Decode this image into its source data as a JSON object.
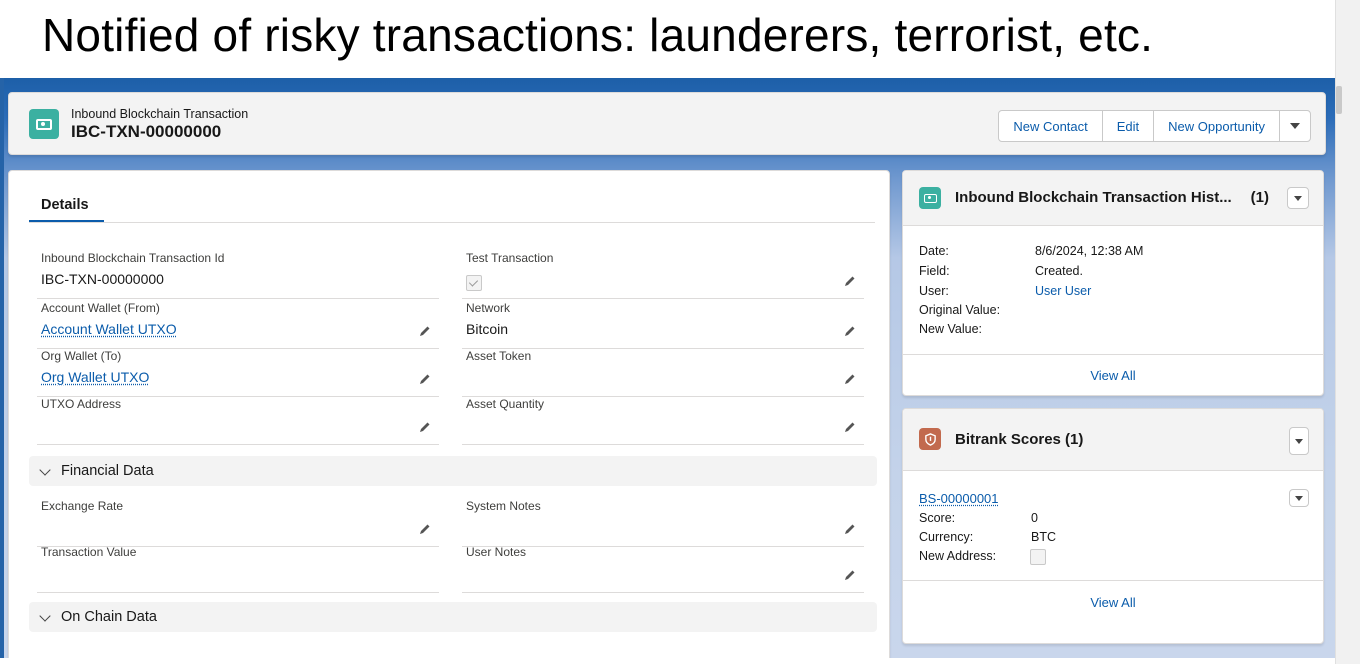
{
  "slide": {
    "title": "Notified of risky transactions: launderers, terrorist, etc."
  },
  "header": {
    "object_label": "Inbound Blockchain Transaction",
    "record_name": "IBC-TXN-00000000",
    "buttons": {
      "new_contact": "New Contact",
      "edit": "Edit",
      "new_opportunity": "New Opportunity"
    }
  },
  "details": {
    "tab_label": "Details",
    "fields": {
      "txn_id": {
        "label": "Inbound Blockchain Transaction Id",
        "value": "IBC-TXN-00000000"
      },
      "test_txn": {
        "label": "Test Transaction",
        "checked": true
      },
      "account_wallet": {
        "label": "Account Wallet (From)",
        "value": "Account Wallet UTXO"
      },
      "network": {
        "label": "Network",
        "value": "Bitcoin"
      },
      "org_wallet": {
        "label": "Org Wallet (To)",
        "value": "Org Wallet UTXO"
      },
      "asset_token": {
        "label": "Asset Token",
        "value": ""
      },
      "utxo_address": {
        "label": "UTXO Address",
        "value": ""
      },
      "asset_quantity": {
        "label": "Asset Quantity",
        "value": ""
      },
      "exchange_rate": {
        "label": "Exchange Rate",
        "value": ""
      },
      "system_notes": {
        "label": "System Notes",
        "value": ""
      },
      "transaction_value": {
        "label": "Transaction Value",
        "value": ""
      },
      "user_notes": {
        "label": "User Notes",
        "value": ""
      }
    },
    "sections": {
      "financial": "Financial Data",
      "on_chain": "On Chain Data"
    }
  },
  "history": {
    "title": "Inbound Blockchain Transaction Hist...",
    "count": "(1)",
    "labels": {
      "date": "Date:",
      "field": "Field:",
      "user": "User:",
      "original": "Original Value:",
      "new": "New Value:"
    },
    "values": {
      "date": "8/6/2024, 12:38 AM",
      "field": "Created.",
      "user": "User User",
      "original": "",
      "new": ""
    },
    "view_all": "View All"
  },
  "bitrank": {
    "title": "Bitrank Scores (1)",
    "record": "BS-00000001",
    "labels": {
      "score": "Score:",
      "currency": "Currency:",
      "new_address": "New Address:"
    },
    "values": {
      "score": "0",
      "currency": "BTC"
    },
    "view_all": "View All"
  },
  "colors": {
    "brand_blue": "#0b5cab",
    "object_teal": "#3bb0a1",
    "bitrank_icon": "#c26a4e",
    "frame_blue": "#2b6cb8"
  }
}
